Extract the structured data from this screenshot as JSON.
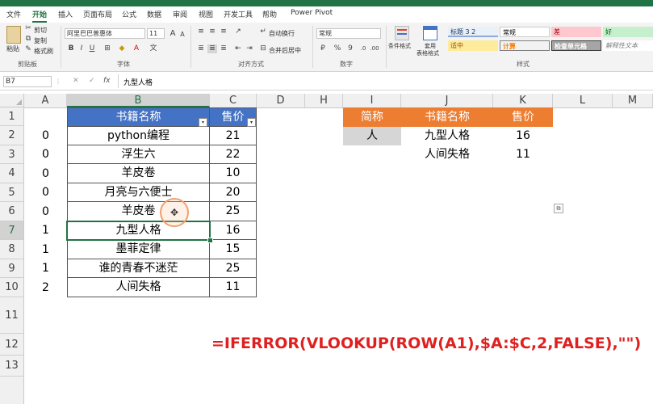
{
  "ribbon_tabs": [
    "文件",
    "开始",
    "插入",
    "页面布局",
    "公式",
    "数据",
    "审阅",
    "视图",
    "开发工具",
    "帮助",
    "Power Pivot"
  ],
  "ribbon": {
    "clipboard": {
      "paste": "粘贴",
      "cut": "剪切",
      "copy": "复制",
      "format_painter": "格式刷",
      "group": "剪贴板"
    },
    "font": {
      "name": "阿里巴巴普惠体",
      "size": "11",
      "bold": "B",
      "italic": "I",
      "underline": "U",
      "grow": "A",
      "shrink": "A",
      "group": "字体"
    },
    "alignment": {
      "wrap": "自动换行",
      "merge": "合并后居中",
      "group": "对齐方式"
    },
    "number": {
      "format": "常规",
      "currency": "₽",
      "percent": "%",
      "comma": "9",
      "group": "数字"
    },
    "styles": {
      "cond_format": "条件格式",
      "table_format_1": "套用",
      "table_format_2": "表格格式",
      "group": "样式",
      "cells": [
        "标题 3 2",
        "常规",
        "差",
        "好",
        "适中",
        "计算",
        "检查单元格",
        "解释性文本"
      ]
    }
  },
  "formula_bar": {
    "name_box": "B7",
    "cancel": "✕",
    "enter": "✓",
    "fx": "fx",
    "content": "九型人格"
  },
  "columns": [
    "A",
    "B",
    "C",
    "D",
    "H",
    "I",
    "J",
    "K",
    "L",
    "M"
  ],
  "rows": [
    "1",
    "2",
    "3",
    "4",
    "5",
    "6",
    "7",
    "8",
    "9",
    "10",
    "11",
    "12",
    "13"
  ],
  "col_a": [
    "0",
    "0",
    "0",
    "0",
    "0",
    "1",
    "1",
    "1",
    "2"
  ],
  "main_table": {
    "headers": [
      "书籍名称",
      "售价"
    ],
    "rows": [
      [
        "python编程",
        "21"
      ],
      [
        "浮生六",
        "22"
      ],
      [
        "羊皮卷",
        "10"
      ],
      [
        "月亮与六便士",
        "20"
      ],
      [
        "羊皮卷",
        "25"
      ],
      [
        "九型人格",
        "16"
      ],
      [
        "墨菲定律",
        "15"
      ],
      [
        "谁的青春不迷茫",
        "25"
      ],
      [
        "人间失格",
        "11"
      ]
    ]
  },
  "lookup_table": {
    "headers": [
      "简称",
      "书籍名称",
      "售价"
    ],
    "key": "人",
    "rows": [
      [
        "九型人格",
        "16"
      ],
      [
        "人间失格",
        "11"
      ]
    ]
  },
  "formula_annotation": "=IFERROR(VLOOKUP(ROW(A1),$A:$C,2,FALSE),\"\")",
  "colors": {
    "excel_green": "#217346",
    "table_header_blue": "#4472c4",
    "lookup_header_orange": "#ed7d31",
    "formula_red": "#e02020"
  }
}
